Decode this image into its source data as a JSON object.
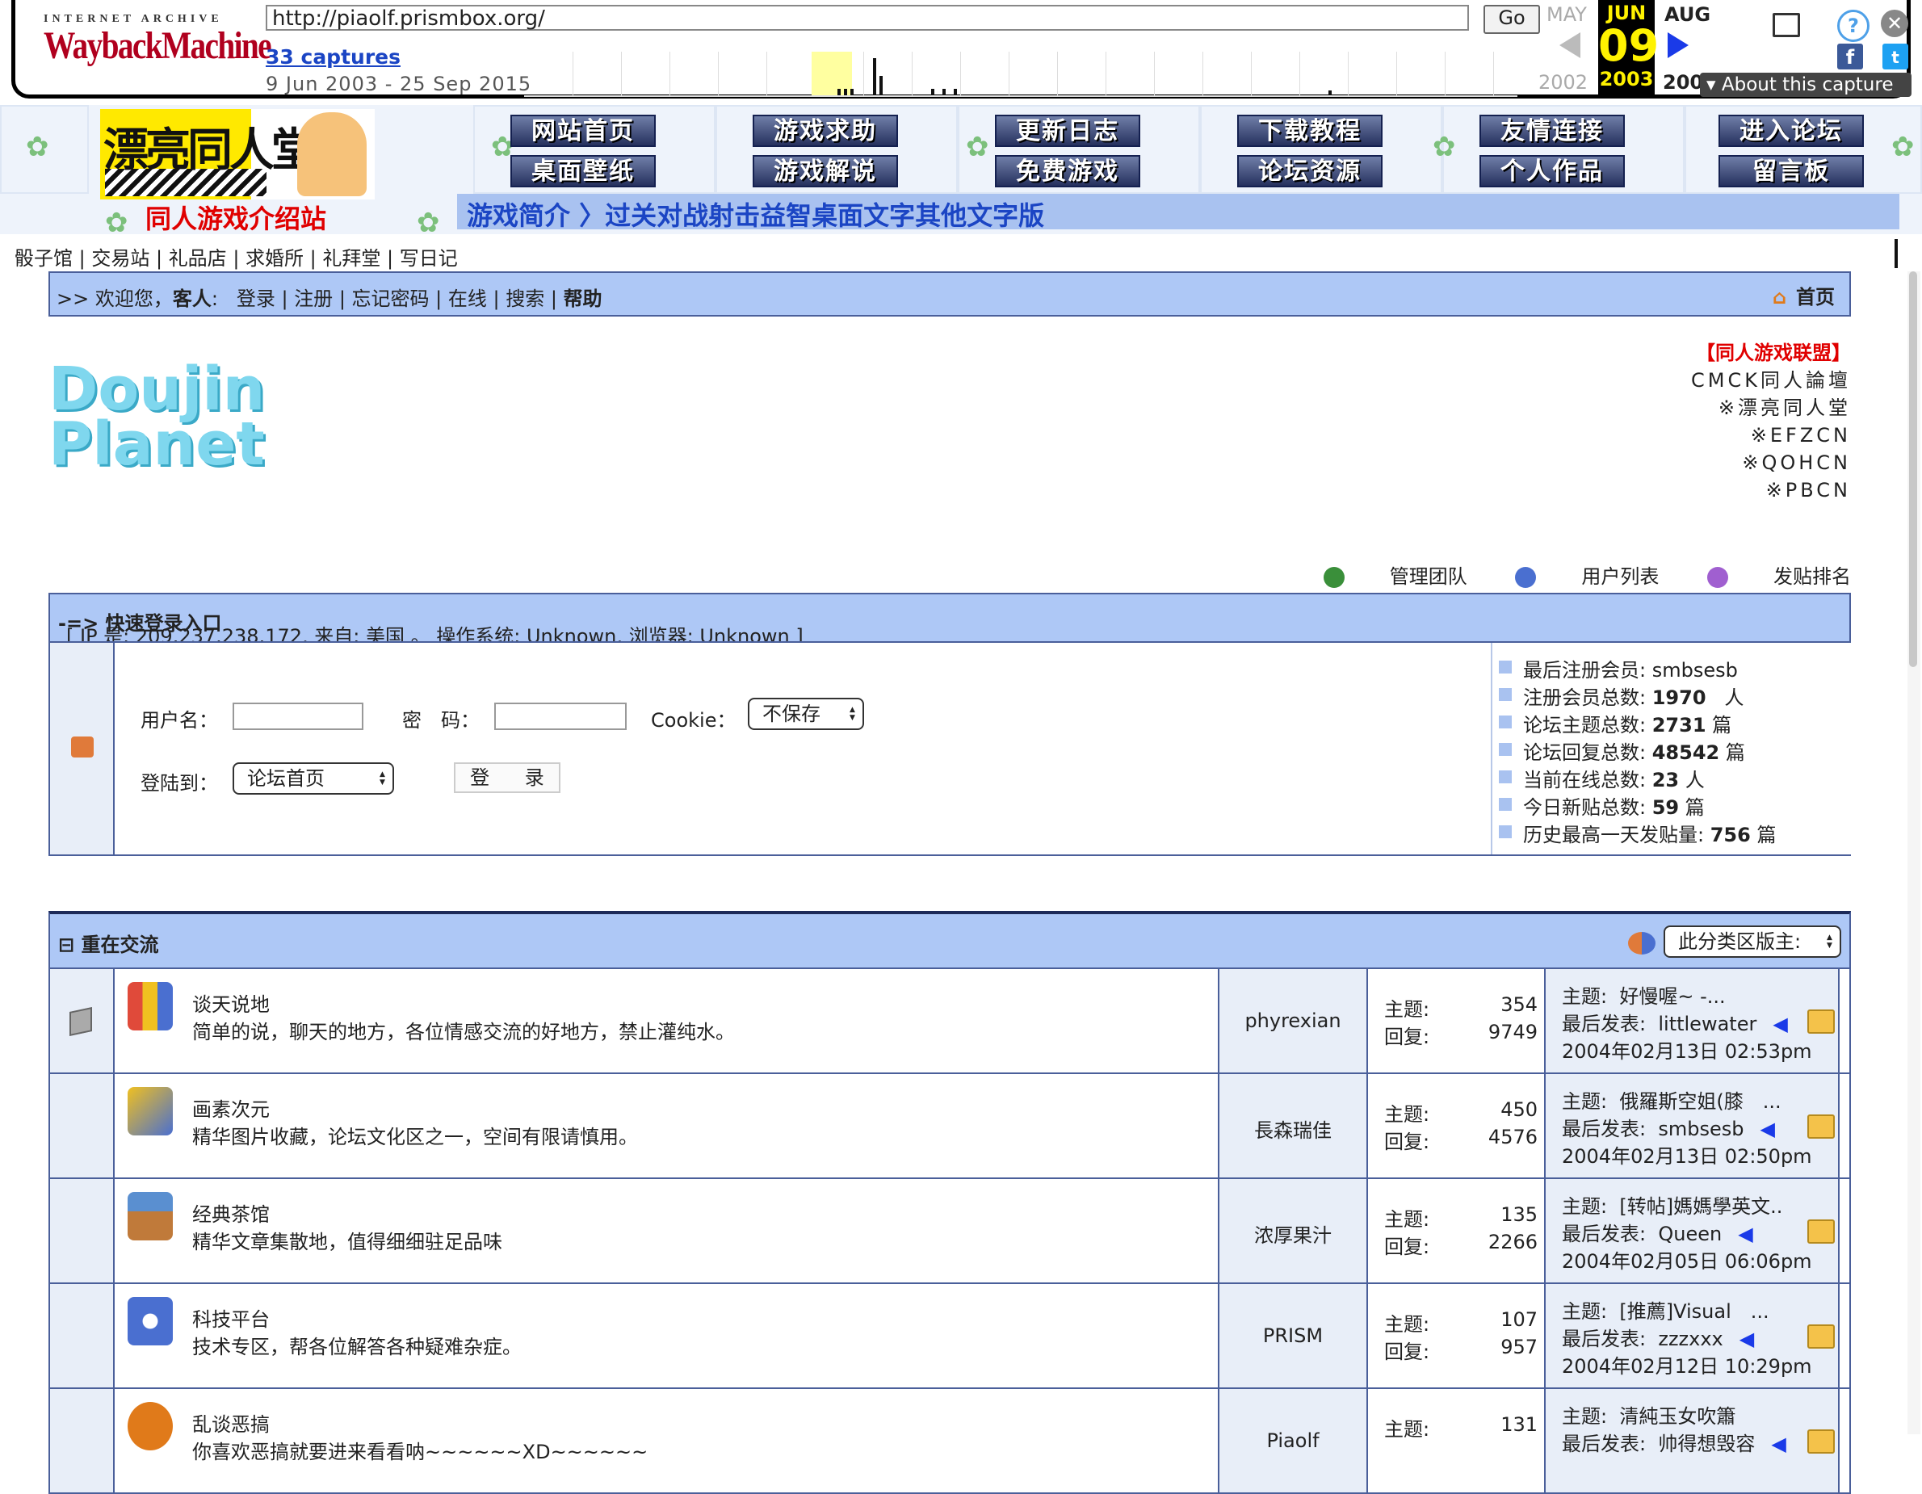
{
  "wayback": {
    "logo_top": "INTERNET ARCHIVE",
    "logo_main": "WaybackMachine",
    "url": "http://piaolf.prismbox.org/",
    "go": "Go",
    "captures": "33 captures",
    "range": "9 Jun 2003 - 25 Sep 2015",
    "prev_month": "MAY",
    "cur_month": "JUN",
    "next_month": "AUG",
    "day": "09",
    "prev_year": "2002",
    "cur_year": "2003",
    "next_year": "200",
    "about": "About this capture",
    "colors": {
      "current_bg": "#000000",
      "current_fg": "#fff200",
      "next_arrow": "#1a3ae8"
    }
  },
  "site": {
    "logo_text": "漂亮同人堂",
    "nav_row1": [
      "网站首页",
      "游戏求助",
      "更新日志",
      "下载教程",
      "友情连接",
      "进入论坛"
    ],
    "nav_row2": [
      "桌面壁纸",
      "游戏解说",
      "免费游戏",
      "论坛资源",
      "个人作品",
      "留言板"
    ],
    "intro_title": "同人游戏介绍站",
    "intro_bar": "游戏简介 〉过关对战射击益智桌面文字其他文字版",
    "shop_links": [
      "骰子馆",
      "交易站",
      "礼品店",
      "求婚所",
      "礼拜堂",
      "写日记"
    ]
  },
  "welcome": {
    "prefix": ">> 欢迎您，",
    "guest": "客人",
    "links": [
      "登录",
      "注册",
      "忘记密码",
      "在线",
      "搜索",
      "帮助"
    ],
    "home": "首页"
  },
  "forum_logo": [
    "Doujin",
    "Planet"
  ],
  "alliance": {
    "title": "【同人游戏联盟】",
    "items": [
      "CMCK同人論壇",
      "※漂亮同人堂",
      "※EFZCN",
      "※QOHCN",
      "※PBCN"
    ]
  },
  "tools": [
    "管理团队",
    "用户列表",
    "发贴排名"
  ],
  "quick_login": {
    "title": "-=> 快速登录入口",
    "info": "[ IP 是: 209.237.238.172,  来自: 美国 。  操作系统: Unknown,  浏览器: Unknown ]",
    "username_label": "用户名：",
    "password_label": "密　码：",
    "cookie_label": "Cookie：",
    "cookie_value": "不保存",
    "loginto_label": "登陆到：",
    "loginto_value": "论坛首页",
    "submit": "登 录"
  },
  "stats": [
    {
      "label": "最后注册会员:",
      "value": "smbsesb",
      "unit": ""
    },
    {
      "label": "注册会员总数:",
      "value": "1970",
      "unit": "人"
    },
    {
      "label": "论坛主题总数:",
      "value": "2731",
      "unit": "篇"
    },
    {
      "label": "论坛回复总数:",
      "value": "48542",
      "unit": "篇"
    },
    {
      "label": "当前在线总数:",
      "value": "23",
      "unit": "人"
    },
    {
      "label": "今日新贴总数:",
      "value": "59",
      "unit": "篇"
    },
    {
      "label": "历史最高一天发贴量:",
      "value": "756",
      "unit": "篇"
    }
  ],
  "category": {
    "title": "⊟ 重在交流",
    "moderator_select": "此分类区版主:"
  },
  "labels": {
    "topics": "主题:",
    "replies": "回复:",
    "lp_topic": "主题:",
    "lp_by": "最后发表:"
  },
  "boards": [
    {
      "name": "谈天说地",
      "desc": "简单的说，聊天的地方，各位情感交流的好地方，禁止灌纯水。",
      "moderator": "phyrexian",
      "topics": "354",
      "replies": "9749",
      "last_topic": "好慢喔~ -...",
      "last_by": "littlewater",
      "last_time": "2004年02月13日 02:53pm"
    },
    {
      "name": "画素次元",
      "desc": "精华图片收藏，论坛文化区之一，空间有限请慎用。",
      "moderator": "長森瑞佳",
      "topics": "450",
      "replies": "4576",
      "last_topic": "俄羅斯空姐(膝　...",
      "last_by": "smbsesb",
      "last_time": "2004年02月13日 02:50pm"
    },
    {
      "name": "经典茶馆",
      "desc": "精华文章集散地，值得细细驻足品味",
      "moderator": "浓厚果汁",
      "topics": "135",
      "replies": "2266",
      "last_topic": "[转帖]媽媽學英文..",
      "last_by": "Queen",
      "last_time": "2004年02月05日 06:06pm"
    },
    {
      "name": "科技平台",
      "desc": "技术专区，帮各位解答各种疑难杂症。",
      "moderator": "PRISM",
      "topics": "107",
      "replies": "957",
      "last_topic": "[推薦]Visual　...",
      "last_by": "zzzxxx",
      "last_time": "2004年02月12日 10:29pm"
    },
    {
      "name": "乱谈恶搞",
      "desc": "你喜欢恶搞就要进来看看呐~~~~~~XD~~~~~~",
      "moderator": "Piaolf",
      "topics": "131",
      "replies": "",
      "last_topic": "清純玉女吹簫",
      "last_by": "帅得想毁容",
      "last_time": ""
    }
  ]
}
